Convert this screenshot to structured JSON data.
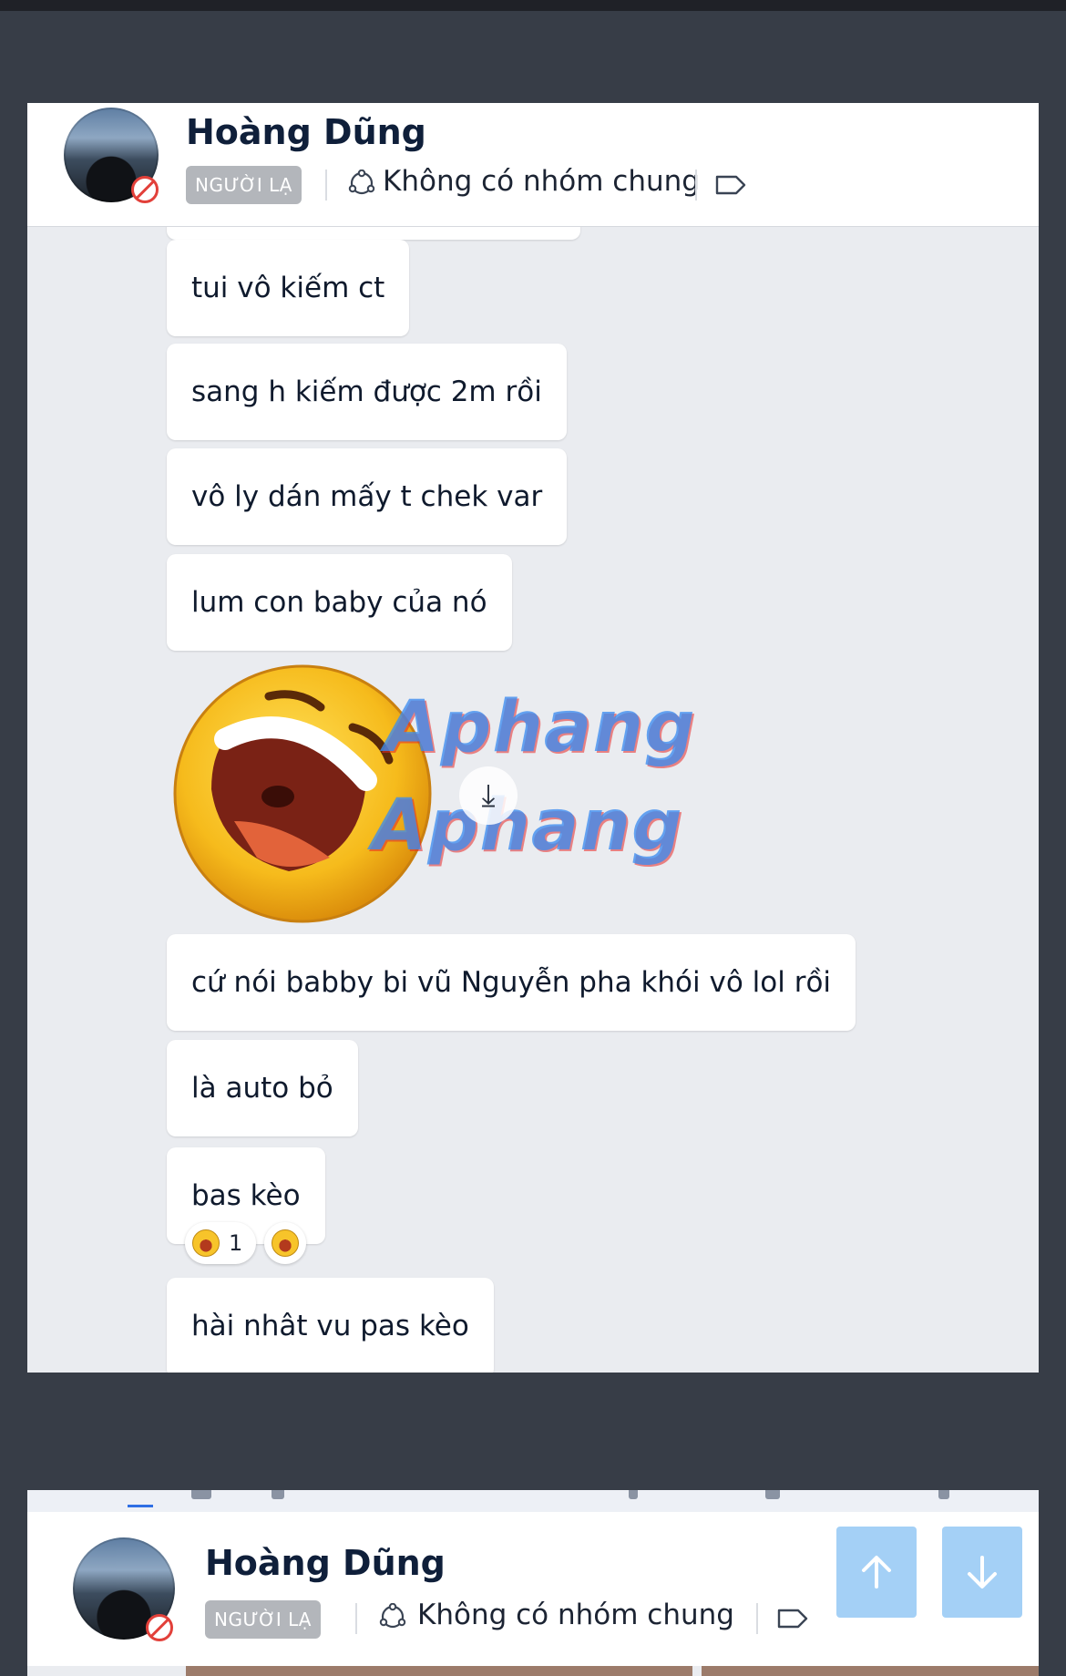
{
  "conversation": {
    "contact_name": "Hoàng Dũng",
    "stranger_tag": "NGƯỜI LẠ",
    "group_status": "Không có nhóm chung"
  },
  "messages": [
    {
      "text": "tui vô kiếm ct"
    },
    {
      "text": "sang h kiếm được 2m rồi"
    },
    {
      "text": "vô ly dán mấy t chek var"
    },
    {
      "text": "lum con baby của nó"
    },
    {
      "text": "cứ nói babby bi vũ Nguyễn pha khói vô lol rồi"
    },
    {
      "text": "là auto bỏ"
    },
    {
      "text": "bas kèo"
    },
    {
      "text": "hài nhât vu pas kèo"
    }
  ],
  "sticker": {
    "icon": "laughing-face-sticker",
    "watermark_line1": "Aphang",
    "watermark_line2": "Aphang"
  },
  "reaction": {
    "count": "1",
    "icon": "laughing-emoji-icon"
  },
  "colors": {
    "header_bg": "#ffffff",
    "chat_bg": "#eaecf0",
    "outer_bg": "#373d47",
    "name_color": "#0f1f3a",
    "stranger_tag_bg": "#b3b6bb",
    "block_red": "#e2403a",
    "nav_button": "#a4d0f6"
  },
  "scroll_buttons": {
    "up_icon": "arrow-up-icon",
    "down_icon": "arrow-down-icon"
  }
}
